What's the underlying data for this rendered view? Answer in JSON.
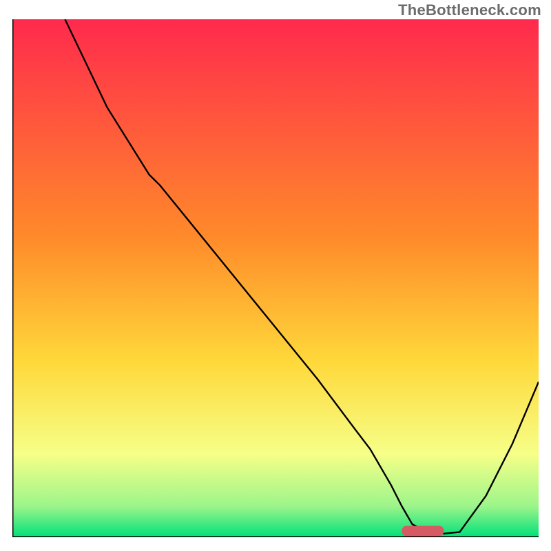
{
  "watermark": "TheBottleneck.com",
  "colors": {
    "curve_stroke": "#000000",
    "optimal_fill": "#d65a63",
    "axis_stroke": "#000000",
    "grad_top": "#ff2a4d",
    "grad_mid1": "#ff8a2a",
    "grad_mid2": "#ffd83a",
    "grad_mid3": "#f6ff88",
    "grad_bot1": "#9cf58a",
    "grad_bot2": "#00e07a"
  },
  "chart_data": {
    "type": "line",
    "title": "",
    "xlabel": "",
    "ylabel": "",
    "xlim": [
      0,
      100
    ],
    "ylim": [
      0,
      100
    ],
    "x": [
      0,
      10,
      18,
      26,
      28,
      38,
      48,
      58,
      65,
      68,
      72,
      74,
      76,
      80,
      85,
      90,
      95,
      100
    ],
    "values": [
      null,
      100,
      83,
      70,
      68,
      55.5,
      43,
      30.5,
      21,
      17,
      10,
      6,
      2.5,
      0.5,
      1.0,
      8,
      18,
      30
    ],
    "optimal_marker": {
      "x_center": 78,
      "y": 1.2,
      "width": 8,
      "height": 2.0
    },
    "background_gradient_stops": [
      {
        "offset": 0,
        "key": "grad_top"
      },
      {
        "offset": 42,
        "key": "grad_mid1"
      },
      {
        "offset": 66,
        "key": "grad_mid2"
      },
      {
        "offset": 84,
        "key": "grad_mid3"
      },
      {
        "offset": 94,
        "key": "grad_bot1"
      },
      {
        "offset": 100,
        "key": "grad_bot2"
      }
    ]
  }
}
